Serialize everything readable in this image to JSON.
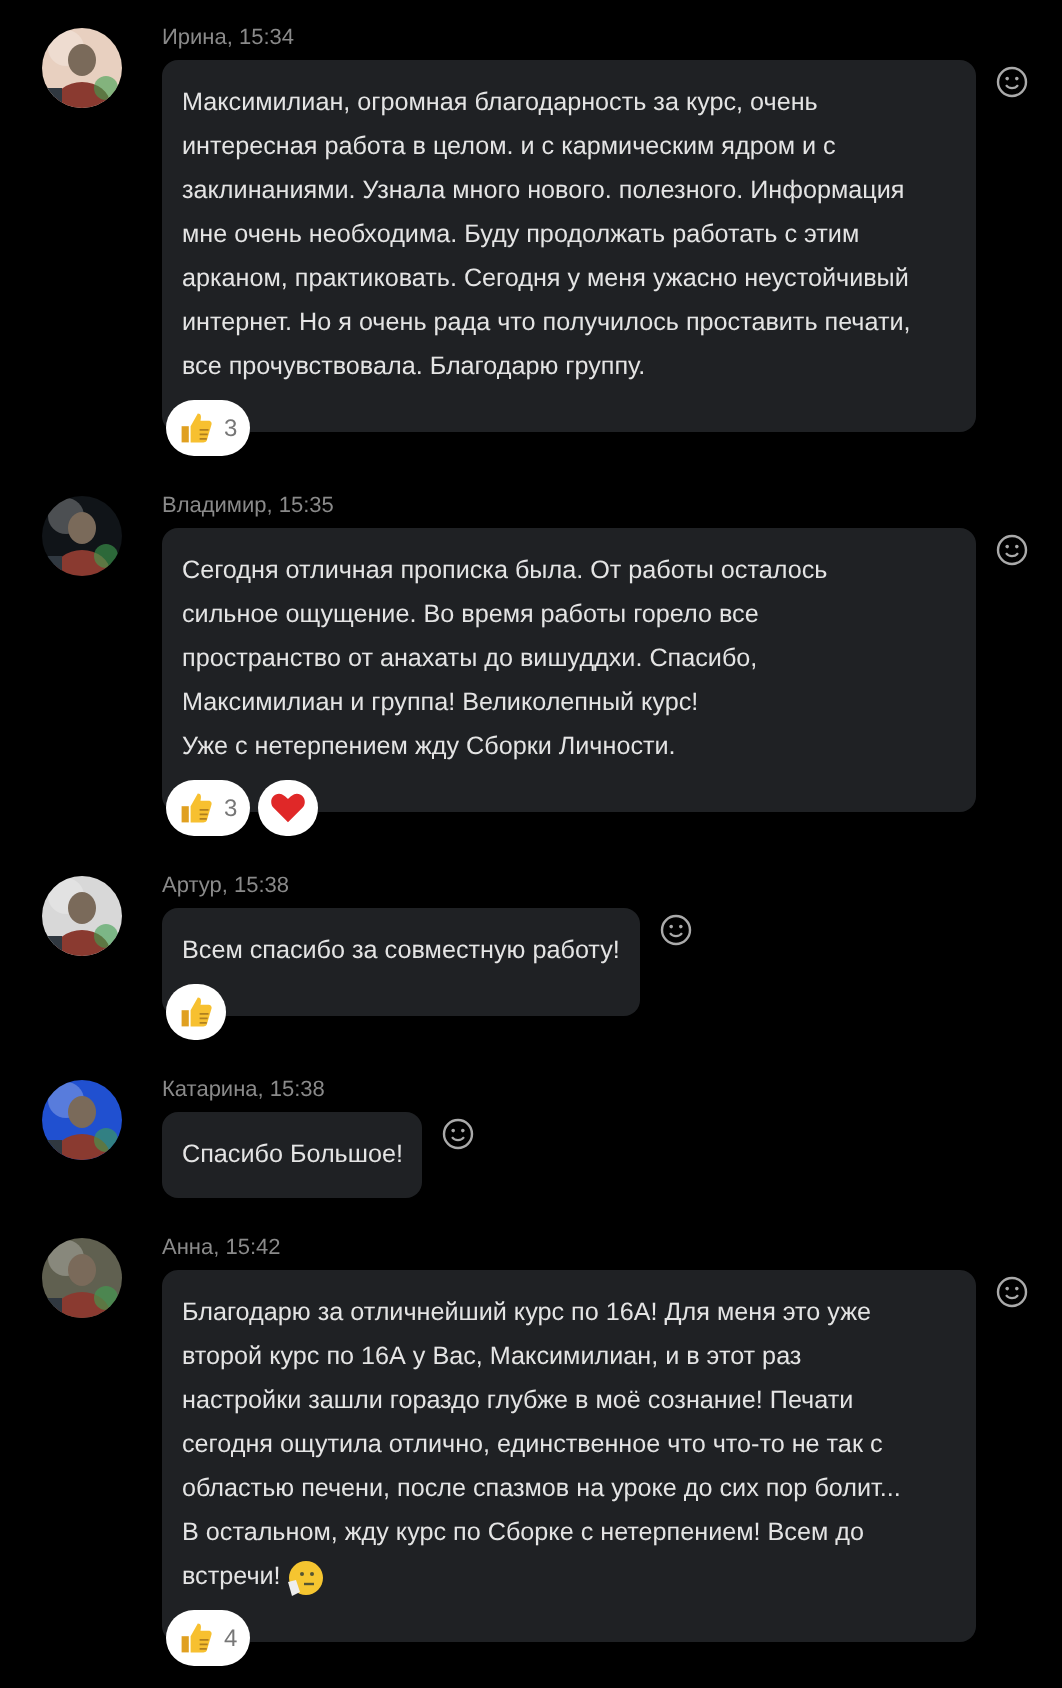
{
  "messages": [
    {
      "header": "Ирина, 15:34",
      "avatar": {
        "kind": "picture"
      },
      "lines": [
        "Максимилиан, огромная благодарность за курс, очень",
        "интересная работа в целом. и с кармическим ядром и с",
        "заклинаниями. Узнала много нового. полезного. Информация",
        "мне очень необходима. Буду продолжать работать с этим",
        "арканом, практиковать. Сегодня у меня ужасно неустойчивый",
        "интернет. Но я очень рада что получилось проставить печати,",
        "все прочувствовала. Благодарю группу."
      ],
      "reactions": [
        {
          "kind": "like",
          "count": "3"
        }
      ]
    },
    {
      "header": "Владимир, 15:35",
      "avatar": {
        "kind": "picture"
      },
      "lines": [
        "Сегодня отличная прописка была. От работы осталось",
        "сильное ощущение. Во время работы горело все",
        "пространство от анахаты до вишуддхи. Спасибо,",
        "Максимилиан и группа! Великолепный курс!",
        "Уже с нетерпением жду Сборки Личности."
      ],
      "reactions": [
        {
          "kind": "like",
          "count": "3"
        },
        {
          "kind": "heart"
        }
      ]
    },
    {
      "header": "Артур, 15:38",
      "avatar": {
        "kind": "picture"
      },
      "lines": [
        "Всем спасибо за совместную работу!"
      ],
      "reactions": [
        {
          "kind": "like"
        }
      ]
    },
    {
      "header": "Катарина, 15:38",
      "avatar": {
        "kind": "picture"
      },
      "lines": [
        "Спасибо Большое!"
      ]
    },
    {
      "header": "Анна, 15:42",
      "avatar": {
        "kind": "picture"
      },
      "lines": [
        "Благодарю за отличнейший курс по 16А! Для меня это уже",
        "второй курс по 16А у Вас, Максимилиан, и в этот раз",
        "настройки зашли гораздо глубже в моё сознание! Печати",
        "сегодня ощутила отлично, единственное что что-то не так с",
        "областью печени, после спазмов на уроке до сих пор болит...",
        "В остальном, жду курс по Сборке с нетерпением! Всем до",
        "встречи!"
      ],
      "end_emoji": true,
      "reactions": [
        {
          "kind": "like",
          "count": "4"
        }
      ]
    }
  ]
}
